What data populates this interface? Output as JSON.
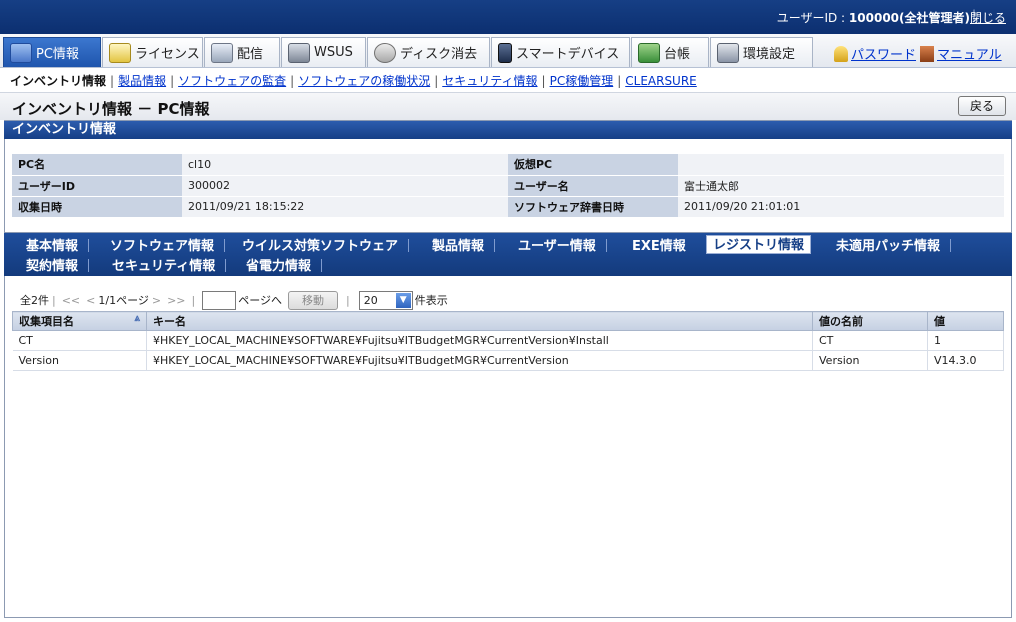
{
  "topbar": {
    "user_prefix": "ユーザーID : ",
    "user_id": "100000(全社管理者)",
    "close_label": "閉じる"
  },
  "main_tabs": [
    {
      "label": "PC情報",
      "icon": "pc-icon",
      "active": true
    },
    {
      "label": "ライセンス",
      "icon": "license-icon"
    },
    {
      "label": "配信",
      "icon": "distribute-icon"
    },
    {
      "label": "WSUS",
      "icon": "wsus-icon"
    },
    {
      "label": "ディスク消去",
      "icon": "disk-erase-icon"
    },
    {
      "label": "スマートデバイス",
      "icon": "smart-device-icon"
    },
    {
      "label": "台帳",
      "icon": "ledger-icon"
    },
    {
      "label": "環境設定",
      "icon": "settings-icon"
    }
  ],
  "top_links": {
    "password": "パスワード",
    "manual": "マニュアル"
  },
  "subnav": {
    "current": "インベントリ情報",
    "links": [
      "製品情報",
      "ソフトウェアの監査",
      "ソフトウェアの稼働状況",
      "セキュリティ情報",
      "PC稼働管理",
      "CLEARSURE"
    ]
  },
  "page_title": "インベントリ情報 － PC情報",
  "back_label": "戻る",
  "section_title": "インベントリ情報",
  "info": {
    "rows": [
      {
        "l1": "PC名",
        "v1": "cl10",
        "l2": "仮想PC",
        "v2": ""
      },
      {
        "l1": "ユーザーID",
        "v1": "300002",
        "l2": "ユーザー名",
        "v2": "富士通太郎"
      },
      {
        "l1": "収集日時",
        "v1": "2011/09/21 18:15:22",
        "l2": "ソフトウェア辞書日時",
        "v2": "2011/09/20 21:01:01"
      }
    ]
  },
  "detail_tabs": [
    "基本情報",
    "ソフトウェア情報",
    "ウイルス対策ソフトウェア",
    "製品情報",
    "ユーザー情報",
    "EXE情報",
    "レジストリ情報",
    "未適用パッチ情報",
    "契約情報",
    "セキュリティ情報",
    "省電力情報"
  ],
  "active_detail_tab": "レジストリ情報",
  "pager": {
    "total": "全2件",
    "first": "<<",
    "prev": "<",
    "page_info": "1/1ページ",
    "next": ">",
    "last": ">>",
    "goto_label": "ページへ",
    "move_label": "移動",
    "page_size": "20",
    "page_size_suffix": "件表示"
  },
  "grid": {
    "headers": [
      "収集項目名",
      "キー名",
      "値の名前",
      "値"
    ],
    "rows": [
      [
        "CT",
        "¥HKEY_LOCAL_MACHINE¥SOFTWARE¥Fujitsu¥ITBudgetMGR¥CurrentVersion¥Install",
        "CT",
        "1"
      ],
      [
        "Version",
        "¥HKEY_LOCAL_MACHINE¥SOFTWARE¥Fujitsu¥ITBudgetMGR¥CurrentVersion",
        "Version",
        "V14.3.0"
      ]
    ]
  }
}
